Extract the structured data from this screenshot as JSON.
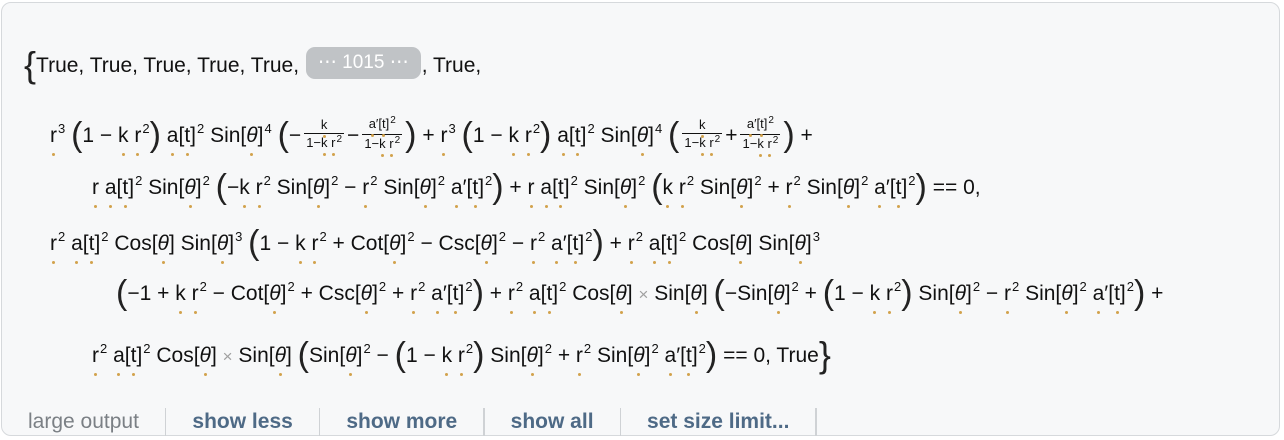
{
  "output": {
    "line1": {
      "prefix": "True, True, True, True, True,",
      "skipped_count": "⋯ 1015 ⋯",
      "suffix": ", True,"
    },
    "equation1_end": "== 0,",
    "equation2_end": "== 0, True"
  },
  "toolbar": {
    "label": "large output",
    "show_less": "show less",
    "show_more": "show more",
    "show_all": "show all",
    "set_size_limit": "set size limit..."
  },
  "colors": {
    "panel_background": "#f7f8f9",
    "panel_border": "#d6d9dc",
    "chip_background": "#c0c3c6",
    "button_text": "#4e6a86",
    "label_text": "#7b8085"
  }
}
